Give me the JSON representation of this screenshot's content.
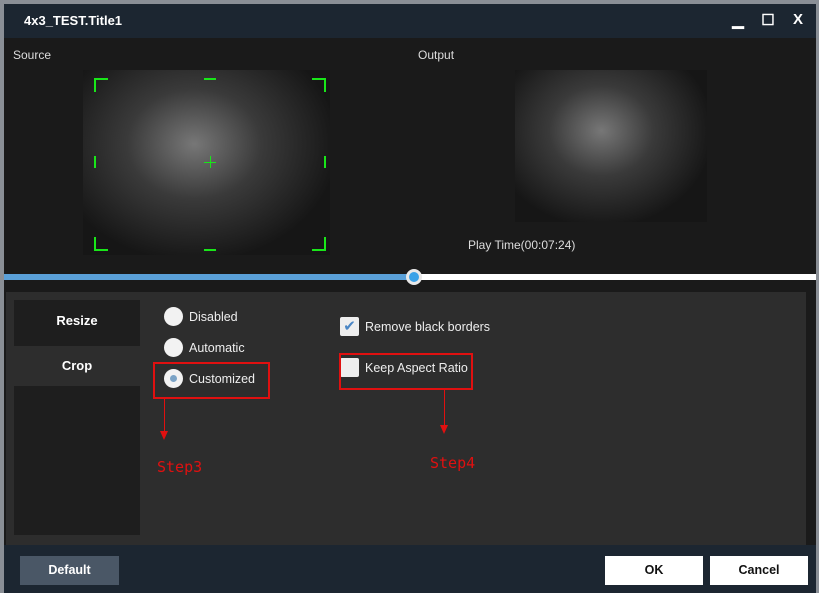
{
  "window": {
    "title": "4x3_TEST.Title1",
    "minimize": "▁",
    "maximize": "☐",
    "close": "X"
  },
  "preview": {
    "source_label": "Source",
    "output_label": "Output",
    "play_time": "Play Time(00:07:24)",
    "progress_percent": 50.5
  },
  "tabs": [
    {
      "label": "Resize"
    },
    {
      "label": "Crop"
    }
  ],
  "crop": {
    "options": [
      {
        "label": "Disabled",
        "selected": false
      },
      {
        "label": "Automatic",
        "selected": false
      },
      {
        "label": "Customized",
        "selected": true
      }
    ],
    "remove_black_borders": {
      "label": "Remove black borders",
      "checked": true
    },
    "keep_aspect_ratio": {
      "label": "Keep Aspect Ratio",
      "checked": false
    }
  },
  "annotations": {
    "step3": "Step3",
    "step4": "Step4"
  },
  "buttons": {
    "default": "Default",
    "ok": "OK",
    "cancel": "Cancel"
  }
}
